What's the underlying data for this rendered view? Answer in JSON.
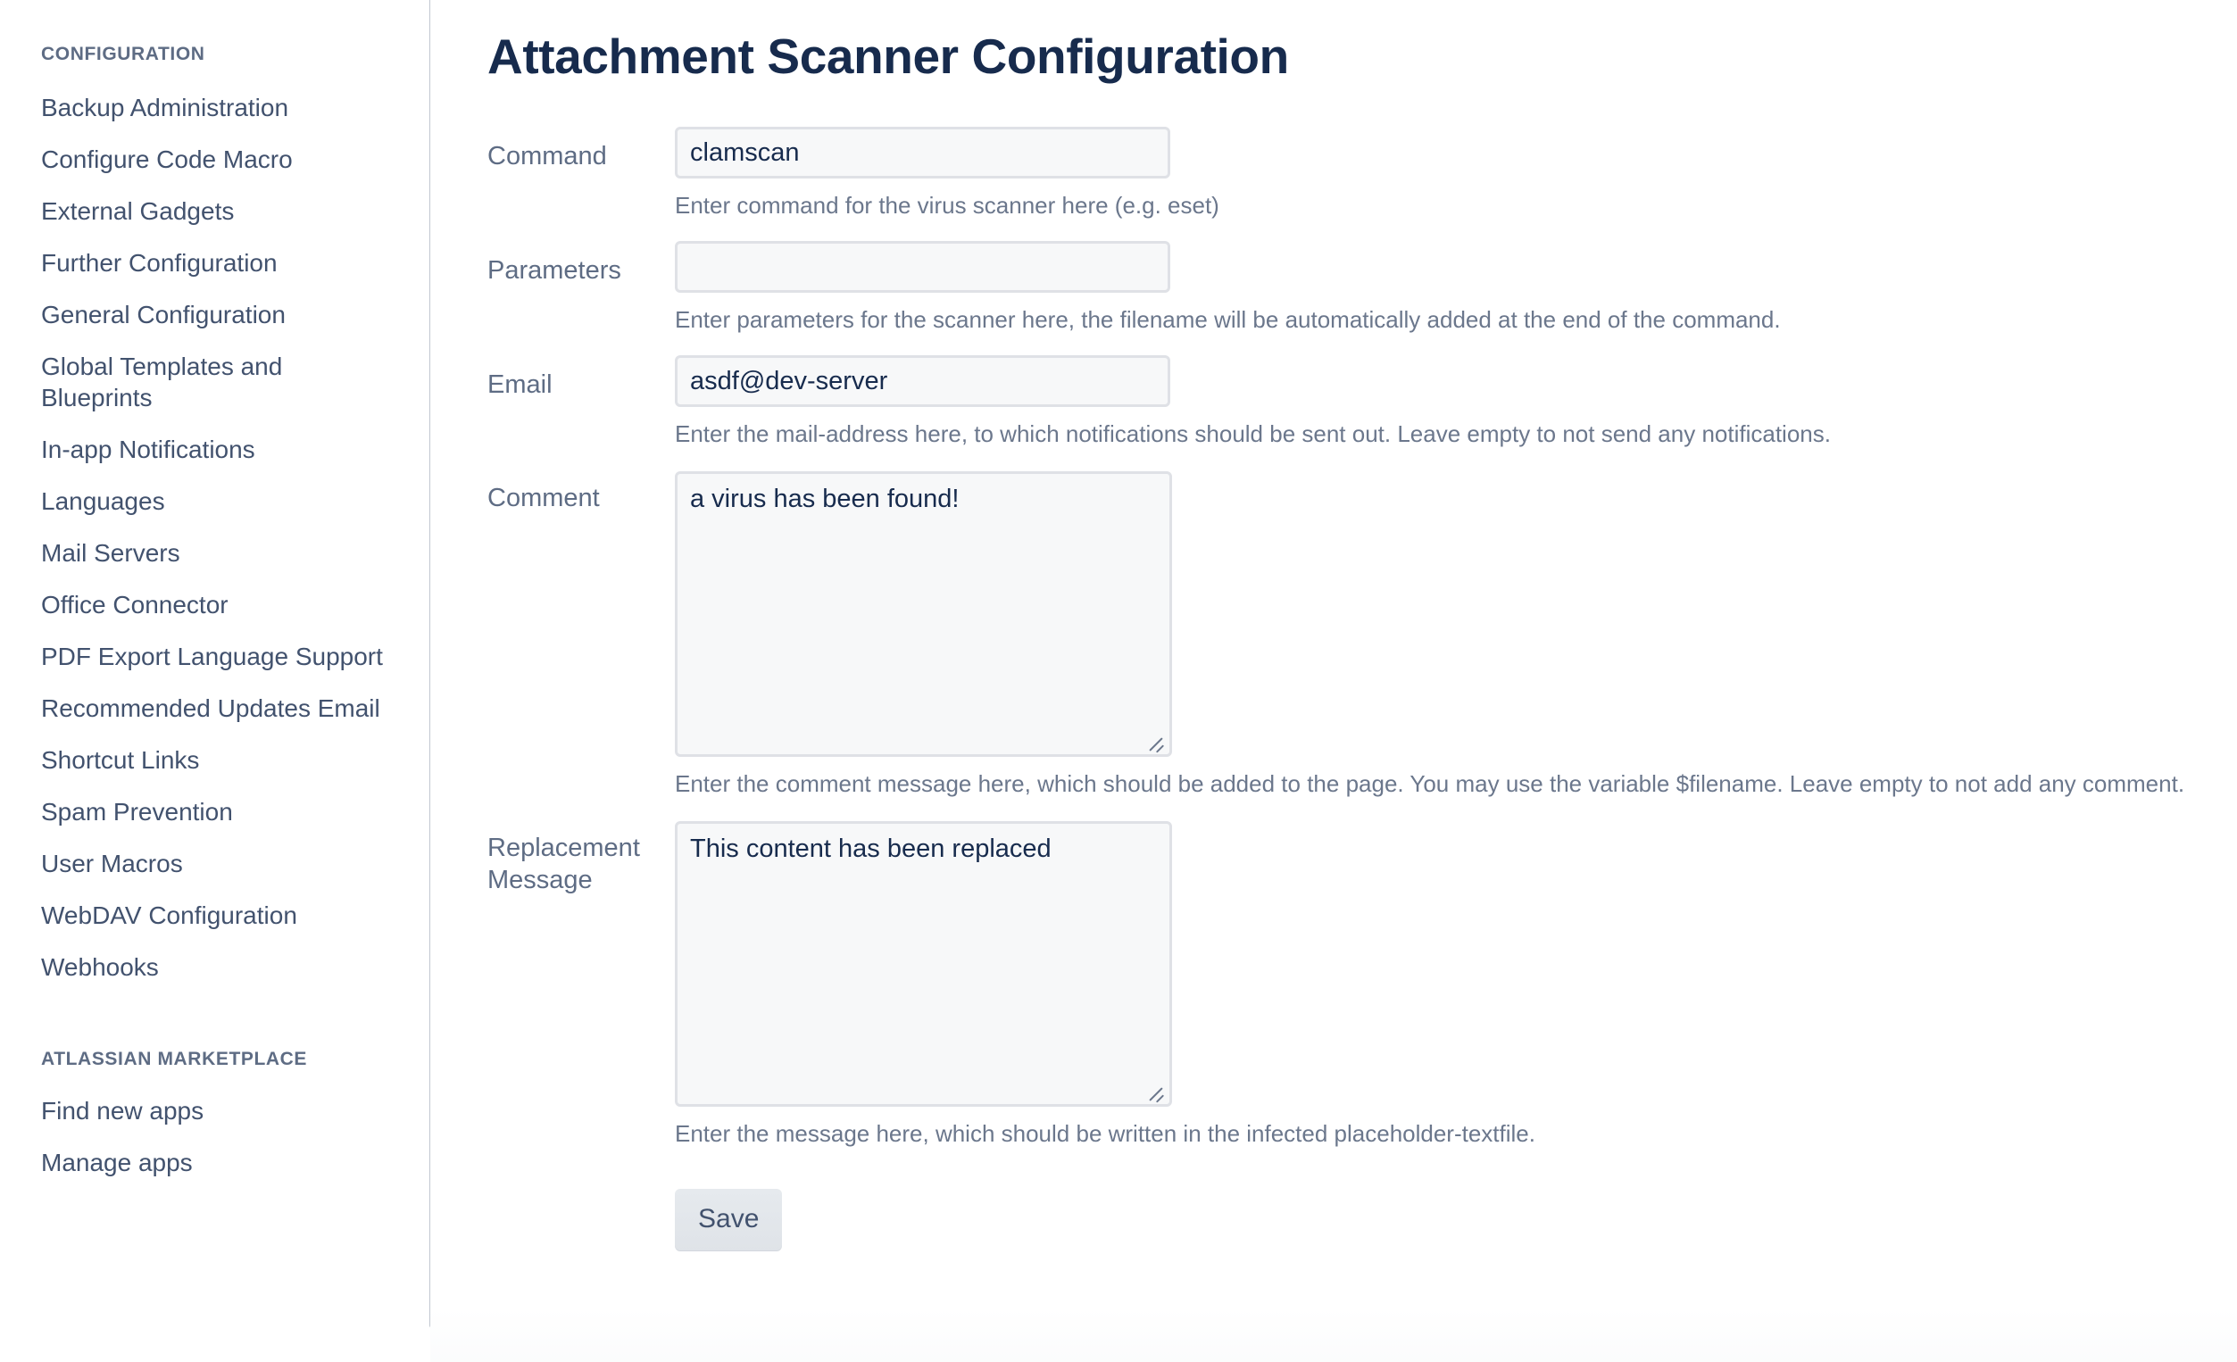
{
  "sidebar": {
    "sections": [
      {
        "heading": "CONFIGURATION",
        "items": [
          {
            "label": "Backup Administration"
          },
          {
            "label": "Configure Code Macro"
          },
          {
            "label": "External Gadgets"
          },
          {
            "label": "Further Configuration"
          },
          {
            "label": "General Configuration"
          },
          {
            "label": "Global Templates and Blueprints"
          },
          {
            "label": "In-app Notifications"
          },
          {
            "label": "Languages"
          },
          {
            "label": "Mail Servers"
          },
          {
            "label": "Office Connector"
          },
          {
            "label": "PDF Export Language Support"
          },
          {
            "label": "Recommended Updates Email"
          },
          {
            "label": "Shortcut Links"
          },
          {
            "label": "Spam Prevention"
          },
          {
            "label": "User Macros"
          },
          {
            "label": "WebDAV Configuration"
          },
          {
            "label": "Webhooks"
          }
        ]
      },
      {
        "heading": "ATLASSIAN MARKETPLACE",
        "items": [
          {
            "label": "Find new apps"
          },
          {
            "label": "Manage apps"
          }
        ]
      }
    ]
  },
  "main": {
    "title": "Attachment Scanner Configuration",
    "fields": {
      "command": {
        "label": "Command",
        "value": "clamscan",
        "placeholder": "",
        "help": "Enter command for the virus scanner here (e.g. eset)"
      },
      "parameters": {
        "label": "Parameters",
        "value": "",
        "placeholder": "",
        "help": "Enter parameters for the scanner here, the filename will be automatically added at the end of the command."
      },
      "email": {
        "label": "Email",
        "value": "asdf@dev-server",
        "placeholder": "",
        "help": "Enter the mail-address here, to which notifications should be sent out. Leave empty to not send any notifications."
      },
      "comment": {
        "label": "Comment",
        "value": "a virus has been found!",
        "placeholder": "",
        "help": "Enter the comment message here, which should be added to the page. You may use the variable $filename. Leave empty to not add any comment."
      },
      "replacement_message": {
        "label": "Replacement Message",
        "value": "This content has been replaced",
        "placeholder": "",
        "help": "Enter the message here, which should be written in the infected placeholder-textfile."
      }
    },
    "save_label": "Save"
  },
  "colors": {
    "title_text": "#172b4d",
    "label_text": "#5e6c84",
    "nav_text": "#42526e",
    "help_text": "#6b778c",
    "input_bg": "#f7f8f9",
    "input_border": "#dfe1e6",
    "divider": "#c1c7d0",
    "button_bg": "#e6eaee"
  }
}
